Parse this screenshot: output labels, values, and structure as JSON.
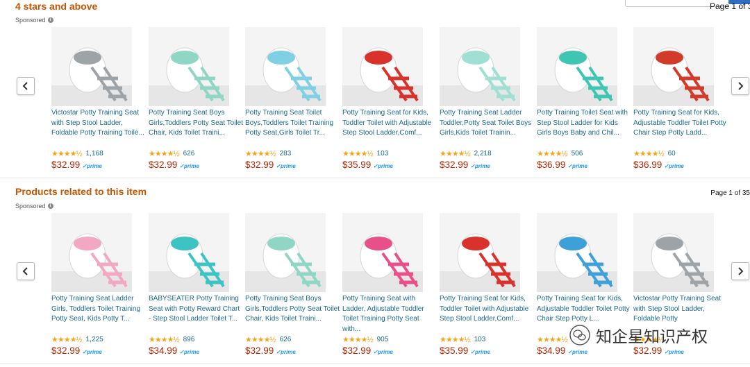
{
  "header": {
    "page_label_partial": "Page 1 of 3"
  },
  "sections": [
    {
      "title": "4 stars and above",
      "sponsored": "Sponsored",
      "page": "",
      "items": [
        {
          "title": "Victostar Potty Training Seat with Step Stool Ladder, Foldable Potty Training Toile...",
          "stars": "★★★★½",
          "reviews": "1,168",
          "price": "$32.99",
          "prime": "✓prime",
          "color": "#9ea3a7"
        },
        {
          "title": "Potty Training Seat Boys Girls,Toddlers Potty Seat Toilet Chair, Kids Toilet Traini...",
          "stars": "★★★★½",
          "reviews": "626",
          "price": "$32.99",
          "prime": "✓prime",
          "color": "#8fd6c4"
        },
        {
          "title": "Potty Training Seat Toilet Boys,Toddlers Toilet Training Potty Seat,Girls Toilet Tr...",
          "stars": "★★★★½",
          "reviews": "283",
          "price": "$32.99",
          "prime": "✓prime",
          "color": "#7fd0e2"
        },
        {
          "title": "Potty Training Seat for Kids, Toddler Toilet with Adjustable Step Stool Ladder,Comf...",
          "stars": "★★★★½",
          "reviews": "103",
          "price": "$35.99",
          "prime": "✓prime",
          "color": "#d9312b"
        },
        {
          "title": "Potty Training Seat Ladder Toddler,Potty Seat Toilet Boys Girls,Kids Toilet Trainin...",
          "stars": "★★★★½",
          "reviews": "2,218",
          "price": "$32.99",
          "prime": "✓prime",
          "color": "#9fe0d2"
        },
        {
          "title": "Potty Training Toilet Seat with Step Stool Ladder for Kids Girls Boys Baby and Chil...",
          "stars": "★★★★½",
          "reviews": "506",
          "price": "$36.99",
          "prime": "✓prime",
          "color": "#3ec6b2"
        },
        {
          "title": "Potty Training Seat for Kids, Adjustable Toddler Toilet Potty Chair Step Potty Ladd...",
          "stars": "★★★★½",
          "reviews": "60",
          "price": "$36.99",
          "prime": "✓prime",
          "color": "#d23a2a"
        }
      ]
    },
    {
      "title": "Products related to this item",
      "sponsored": "Sponsored",
      "page": "Page 1 of 35",
      "items": [
        {
          "title": "Potty Training Seat Ladder Girls, Toddlers Toilet Training Potty Seat, Kids Potty T...",
          "stars": "★★★★½",
          "reviews": "1,225",
          "price": "$32.99",
          "prime": "✓prime",
          "color": "#f2a8c3"
        },
        {
          "title": "BABYSEATER Potty Training Seat with Potty Reward Chart - Step Stool Ladder Toilet T...",
          "stars": "★★★★½",
          "reviews": "896",
          "price": "$34.99",
          "prime": "✓prime",
          "color": "#3cc3c4"
        },
        {
          "title": "Potty Training Seat Boys Girls,Toddlers Potty Seat Toilet Chair, Kids Toilet Traini...",
          "stars": "★★★★½",
          "reviews": "626",
          "price": "$32.99",
          "prime": "✓prime",
          "color": "#8fd6c4"
        },
        {
          "title": "Potty Training Seat with Ladder, Adjustable Toddler Toilet Training Potty Seat with...",
          "stars": "★★★★½",
          "reviews": "905",
          "price": "$32.99",
          "prime": "✓prime",
          "color": "#e8508a"
        },
        {
          "title": "Potty Training Seat for Kids, Toddler Toilet with Adjustable Step Stool Ladder,Comf...",
          "stars": "★★★★½",
          "reviews": "103",
          "price": "$35.99",
          "prime": "✓prime",
          "color": "#d9312b"
        },
        {
          "title": "Potty Training Seat for Kids, Adjustable Toddler Toilet Potty Chair Step Potty L...",
          "stars": "★★★★½",
          "reviews": "",
          "price": "$34.99",
          "prime": "✓prime",
          "color": "#3ea0d8"
        },
        {
          "title": "Victostar Potty Training Seat with Step Stool Ladder, Foldable Potty",
          "stars": "★★★★½",
          "reviews": "",
          "price": "$32.99",
          "prime": "✓prime",
          "color": "#9ea3a7"
        }
      ]
    }
  ],
  "watermark": "知企星知识产权",
  "colors": {
    "section_title": "#c45500",
    "link": "#1b6a8a",
    "price": "#b12704",
    "star": "#f4a41b",
    "prime": "#1a98ff"
  }
}
